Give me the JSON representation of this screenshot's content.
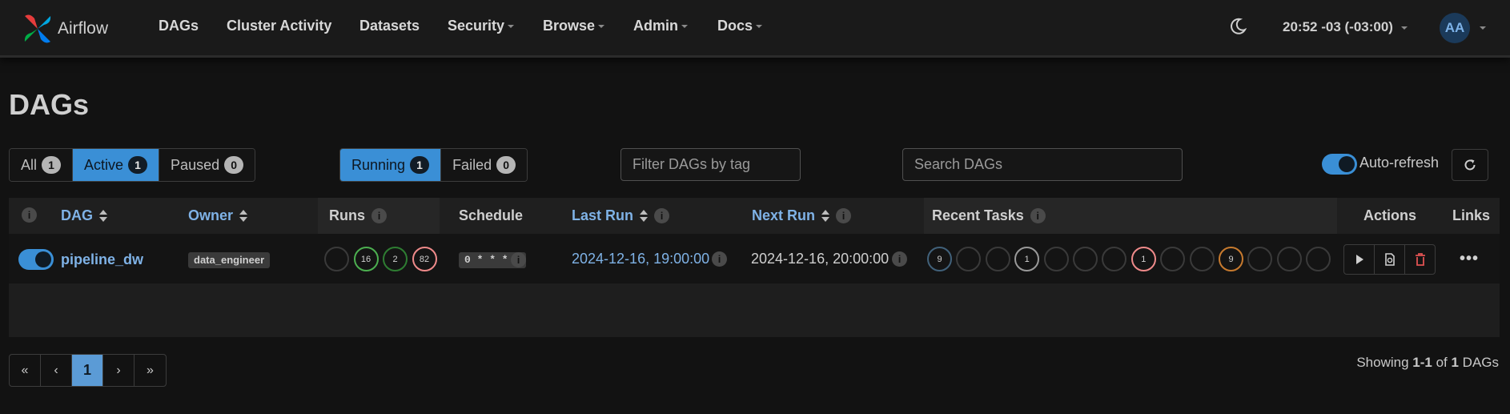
{
  "navbar": {
    "brand": "Airflow",
    "items": [
      "DAGs",
      "Cluster Activity",
      "Datasets",
      "Security",
      "Browse",
      "Admin",
      "Docs"
    ],
    "clock": "20:52 -03 (-03:00)",
    "avatar_initials": "AA"
  },
  "page_title": "DAGs",
  "status_filter": {
    "all": {
      "label": "All",
      "count": "1"
    },
    "active": {
      "label": "Active",
      "count": "1"
    },
    "paused": {
      "label": "Paused",
      "count": "0"
    }
  },
  "run_filter": {
    "running": {
      "label": "Running",
      "count": "1"
    },
    "failed": {
      "label": "Failed",
      "count": "0"
    }
  },
  "tag_filter_placeholder": "Filter DAGs by tag",
  "search_placeholder": "Search DAGs",
  "auto_refresh_label": "Auto-refresh",
  "columns": {
    "dag": "DAG",
    "owner": "Owner",
    "runs": "Runs",
    "schedule": "Schedule",
    "last_run": "Last Run",
    "next_run": "Next Run",
    "recent_tasks": "Recent Tasks",
    "actions": "Actions",
    "links": "Links"
  },
  "row": {
    "dag_id": "pipeline_dw",
    "owner": "data_engineer",
    "runs": [
      {
        "count": "",
        "color": "#3a3a3a"
      },
      {
        "count": "16",
        "color": "#4caf50"
      },
      {
        "count": "2",
        "color": "#2e7d32"
      },
      {
        "count": "82",
        "color": "#ef8a8a"
      }
    ],
    "schedule": "0 * * * *",
    "last_run": "2024-12-16, 19:00:00",
    "next_run": "2024-12-16, 20:00:00",
    "recent_tasks": [
      {
        "count": "9",
        "color": "#41617a"
      },
      {
        "count": "",
        "color": "#3a3a3a"
      },
      {
        "count": "",
        "color": "#3a3a3a"
      },
      {
        "count": "1",
        "color": "#9a9a9a"
      },
      {
        "count": "",
        "color": "#3a3a3a"
      },
      {
        "count": "",
        "color": "#3a3a3a"
      },
      {
        "count": "",
        "color": "#3a3a3a"
      },
      {
        "count": "1",
        "color": "#ef8a8a"
      },
      {
        "count": "",
        "color": "#3a3a3a"
      },
      {
        "count": "",
        "color": "#3a3a3a"
      },
      {
        "count": "9",
        "color": "#c77a2e"
      },
      {
        "count": "",
        "color": "#3a3a3a"
      },
      {
        "count": "",
        "color": "#3a3a3a"
      },
      {
        "count": "",
        "color": "#3a3a3a"
      }
    ]
  },
  "pagination": {
    "first": "«",
    "prev": "‹",
    "current": "1",
    "next": "›",
    "last": "»"
  },
  "showing": {
    "prefix": "Showing ",
    "range": "1-1",
    "middle": " of ",
    "total": "1",
    "suffix": " DAGs"
  }
}
